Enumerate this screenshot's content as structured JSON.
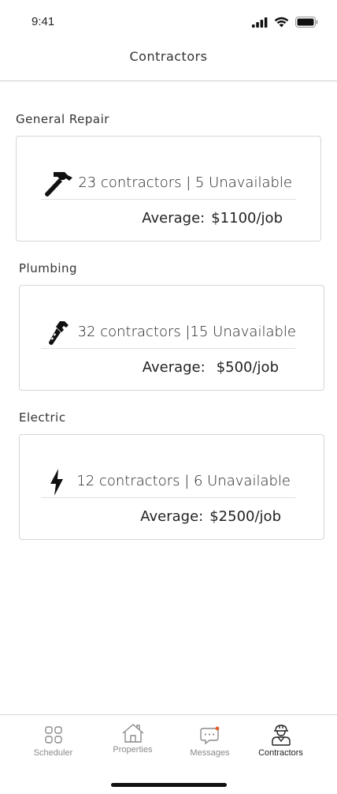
{
  "status_bar": {
    "time": "9:41"
  },
  "header": {
    "title": "Contractors"
  },
  "sections": [
    {
      "title": "General Repair",
      "icon": "hammer-icon",
      "count_text": "23 contractors | 5 Unavailable",
      "avg_label": "Average:",
      "avg_value": "$1100/job"
    },
    {
      "title": "Plumbing",
      "icon": "wrench-icon",
      "count_text": "32 contractors |15 Unavailable",
      "avg_label": "Average:",
      "avg_value": "$500/job"
    },
    {
      "title": "Electric",
      "icon": "lightning-bolt-icon",
      "count_text": "12 contractors | 6 Unavailable",
      "avg_label": "Average:",
      "avg_value": "$2500/job"
    }
  ],
  "tabs": [
    {
      "label": "Scheduler",
      "icon": "grid-icon",
      "active": false
    },
    {
      "label": "Properties",
      "icon": "house-icon",
      "active": false
    },
    {
      "label": "Messages",
      "icon": "chat-bubble-icon",
      "active": false,
      "badge_color": "#e8602c"
    },
    {
      "label": "Contractors",
      "icon": "worker-icon",
      "active": true
    }
  ],
  "colors": {
    "text": "#222222",
    "inactive_tab": "#8a8a8a",
    "badge": "#e8602c",
    "border": "#d6d6d6"
  }
}
